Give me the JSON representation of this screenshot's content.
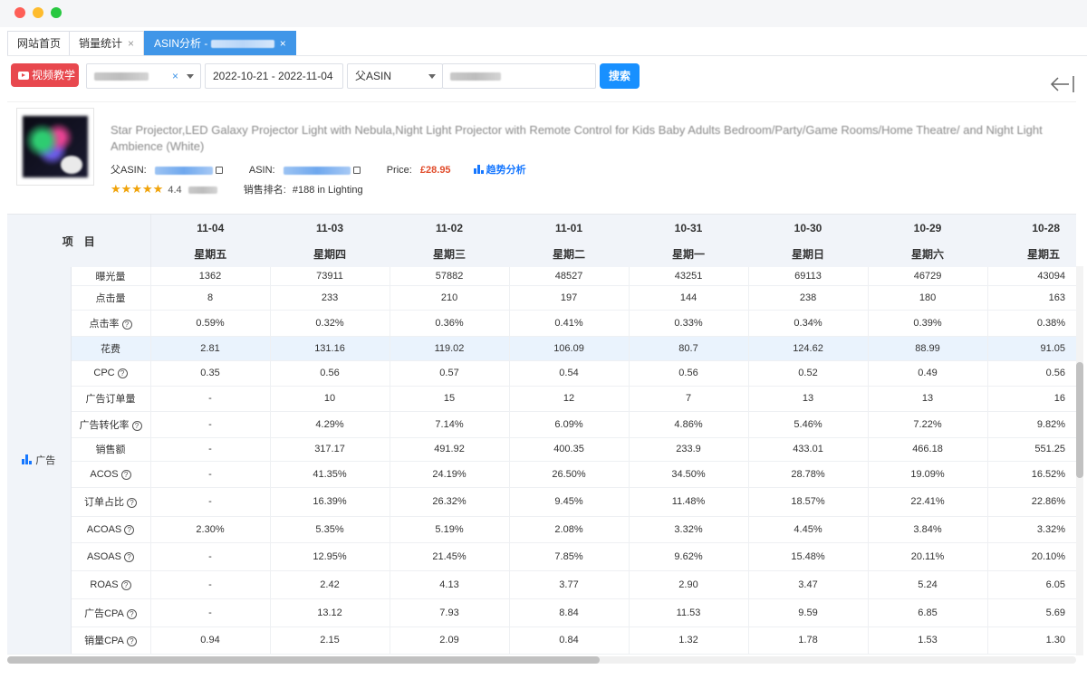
{
  "tabs": [
    {
      "label": "网站首页",
      "closable": false,
      "active": false
    },
    {
      "label": "销量统计",
      "closable": true,
      "active": false
    },
    {
      "label": "ASIN分析 - ",
      "closable": true,
      "active": true
    }
  ],
  "toolbar": {
    "video_button": "视频教学",
    "date_range": "2022-10-21 - 2022-11-04",
    "asin_type": "父ASIN",
    "clear_symbol": "×",
    "search_button": "搜索"
  },
  "product": {
    "title": "Star Projector,LED Galaxy Projector Light with Nebula,Night Light Projector with Remote Control for Kids Baby Adults Bedroom/Party/Game Rooms/Home Theatre/ and Night Light Ambience (White)",
    "parent_asin_label": "父ASIN:",
    "asin_label": "ASIN:",
    "price_label": "Price:",
    "price": "£28.95",
    "trend_label": "趋势分析",
    "stars": "★★★★★",
    "rating": "4.4",
    "rank_label": "销售排名:",
    "rank_value": "#188 in Lighting"
  },
  "table": {
    "item_header": "项　目",
    "category": "广告",
    "dates": [
      "11-04",
      "11-03",
      "11-02",
      "11-01",
      "10-31",
      "10-30",
      "10-29",
      "10-28"
    ],
    "weekdays": [
      "星期五",
      "星期四",
      "星期三",
      "星期二",
      "星期一",
      "星期日",
      "星期六",
      "星期五"
    ],
    "rows": [
      {
        "label": "曝光量",
        "help": false,
        "values": [
          "1362",
          "73911",
          "57882",
          "48527",
          "43251",
          "69113",
          "46729",
          "43094"
        ]
      },
      {
        "label": "点击量",
        "help": false,
        "values": [
          "8",
          "233",
          "210",
          "197",
          "144",
          "238",
          "180",
          "163"
        ]
      },
      {
        "label": "点击率",
        "help": true,
        "values": [
          "0.59%",
          "0.32%",
          "0.36%",
          "0.41%",
          "0.33%",
          "0.34%",
          "0.39%",
          "0.38%"
        ]
      },
      {
        "label": "花费",
        "help": false,
        "highlight": true,
        "values": [
          "2.81",
          "131.16",
          "119.02",
          "106.09",
          "80.7",
          "124.62",
          "88.99",
          "91.05"
        ]
      },
      {
        "label": "CPC",
        "help": true,
        "values": [
          "0.35",
          "0.56",
          "0.57",
          "0.54",
          "0.56",
          "0.52",
          "0.49",
          "0.56"
        ]
      },
      {
        "label": "广告订单量",
        "help": false,
        "values": [
          "-",
          "10",
          "15",
          "12",
          "7",
          "13",
          "13",
          "16"
        ]
      },
      {
        "label": "广告转化率",
        "help": true,
        "values": [
          "-",
          "4.29%",
          "7.14%",
          "6.09%",
          "4.86%",
          "5.46%",
          "7.22%",
          "9.82%"
        ]
      },
      {
        "label": "销售额",
        "help": false,
        "values": [
          "-",
          "317.17",
          "491.92",
          "400.35",
          "233.9",
          "433.01",
          "466.18",
          "551.25"
        ]
      },
      {
        "label": "ACOS",
        "help": true,
        "values": [
          "-",
          "41.35%",
          "24.19%",
          "26.50%",
          "34.50%",
          "28.78%",
          "19.09%",
          "16.52%"
        ]
      },
      {
        "label": "订单占比",
        "help": true,
        "values": [
          "-",
          "16.39%",
          "26.32%",
          "9.45%",
          "11.48%",
          "18.57%",
          "22.41%",
          "22.86%"
        ]
      },
      {
        "label": "ACOAS",
        "help": true,
        "values": [
          "2.30%",
          "5.35%",
          "5.19%",
          "2.08%",
          "3.32%",
          "4.45%",
          "3.84%",
          "3.32%"
        ]
      },
      {
        "label": "ASOAS",
        "help": true,
        "values": [
          "-",
          "12.95%",
          "21.45%",
          "7.85%",
          "9.62%",
          "15.48%",
          "20.11%",
          "20.10%"
        ]
      },
      {
        "label": "ROAS",
        "help": true,
        "values": [
          "-",
          "2.42",
          "4.13",
          "3.77",
          "2.90",
          "3.47",
          "5.24",
          "6.05"
        ]
      },
      {
        "label": "广告CPA",
        "help": true,
        "values": [
          "-",
          "13.12",
          "7.93",
          "8.84",
          "11.53",
          "9.59",
          "6.85",
          "5.69"
        ]
      },
      {
        "label": "销量CPA",
        "help": true,
        "values": [
          "0.94",
          "2.15",
          "2.09",
          "0.84",
          "1.32",
          "1.78",
          "1.53",
          "1.30"
        ]
      }
    ]
  }
}
